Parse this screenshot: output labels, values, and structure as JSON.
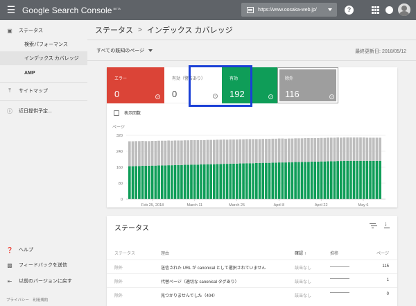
{
  "app": {
    "brand": "Google Search Console",
    "badge": "BETA",
    "property_url": "https://www.oosaka-web.jp/"
  },
  "sidebar": {
    "items": [
      {
        "label": "ステータス",
        "icon": "status-icon"
      },
      {
        "label": "検索パフォーマンス"
      },
      {
        "label": "インデックス カバレッジ"
      },
      {
        "label": "AMP"
      },
      {
        "label": "サイトマップ",
        "icon": "sitemap-icon"
      },
      {
        "label": "近日提供予定...",
        "icon": "info-icon"
      }
    ],
    "bottom": [
      {
        "label": "ヘルプ",
        "icon": "help-icon"
      },
      {
        "label": "フィードバックを送信",
        "icon": "feedback-icon"
      },
      {
        "label": "以前のバージョンに戻す",
        "icon": "back-icon"
      }
    ],
    "footer": "プライバシー　利用規約"
  },
  "header": {
    "crumb1": "ステータス",
    "sep": ">",
    "crumb2": "インデックス カバレッジ"
  },
  "filter": {
    "label": "すべての既知のページ",
    "updated": "最終更新日: 2018/05/12"
  },
  "stats": {
    "error": {
      "label": "エラー",
      "value": "0"
    },
    "warning": {
      "label": "有効（警告あり）",
      "value": "0"
    },
    "valid": {
      "label": "有効",
      "value": "192"
    },
    "excluded": {
      "label": "除外",
      "value": "116"
    }
  },
  "show_count_label": "表示回数",
  "colors": {
    "error": "#db4437",
    "valid": "#0f9d58",
    "excluded": "#9e9e9e",
    "highlight": "#1a3fd6"
  },
  "chart_data": {
    "type": "bar",
    "ylabel": "ページ",
    "ylim": [
      0,
      320
    ],
    "yticks": [
      0,
      80,
      160,
      240,
      320
    ],
    "xticks": [
      "Feb 25, 2018",
      "March 11",
      "March 25",
      "April 8",
      "April 22",
      "May 6"
    ],
    "series": [
      {
        "name": "有効",
        "color": "#0f9d58",
        "start": 165,
        "end": 192
      },
      {
        "name": "除外",
        "color": "#bdbdbd",
        "start": 125,
        "end": 116
      }
    ],
    "bar_count": 78
  },
  "table": {
    "title": "ステータス",
    "headers": {
      "status": "ステータス",
      "reason": "理由",
      "validation": "確認",
      "trend": "推移",
      "pages": "ページ"
    },
    "rows": [
      {
        "status": "除外",
        "reason": "送信された URL が canonical として選択されていません",
        "validation": "該当なし",
        "pages": "115"
      },
      {
        "status": "除外",
        "reason": "代替ページ（適切な canonical タグあり）",
        "validation": "該当なし",
        "pages": "1"
      },
      {
        "status": "除外",
        "reason": "見つかりませんでした（404）",
        "validation": "該当なし",
        "pages": "0"
      }
    ]
  }
}
